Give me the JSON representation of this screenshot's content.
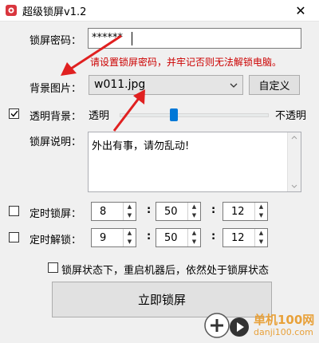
{
  "window": {
    "title": "超级锁屏v1.2",
    "close_glyph": "✕"
  },
  "password": {
    "label": "锁屏密码：",
    "value": "******",
    "warning": "请设置锁屏密码，并牢记否则无法解锁电脑。"
  },
  "background": {
    "label": "背景图片：",
    "selected": "w011.jpg",
    "custom_button": "自定义"
  },
  "transparent": {
    "label": "透明背景：",
    "checked": true,
    "left_label": "透明",
    "right_label": "不透明",
    "level": 0.36
  },
  "description": {
    "label": "锁屏说明：",
    "text": "外出有事，请勿乱动!"
  },
  "timed_lock": {
    "label": "定时锁屏：",
    "checked": false,
    "hour": "8",
    "minute": "50",
    "second": "12"
  },
  "timed_unlock": {
    "label": "定时解锁：",
    "checked": false,
    "hour": "9",
    "minute": "50",
    "second": "12"
  },
  "persist": {
    "label": "锁屏状态下，重启机器后，依然处于锁屏状态",
    "checked": false
  },
  "lock_button": "立即锁屏",
  "watermark": {
    "text": "单机100网",
    "domain": "danji100.com"
  },
  "colors": {
    "warning": "#cc0000",
    "arrow": "#e02020",
    "slider_thumb": "#0078d7"
  }
}
